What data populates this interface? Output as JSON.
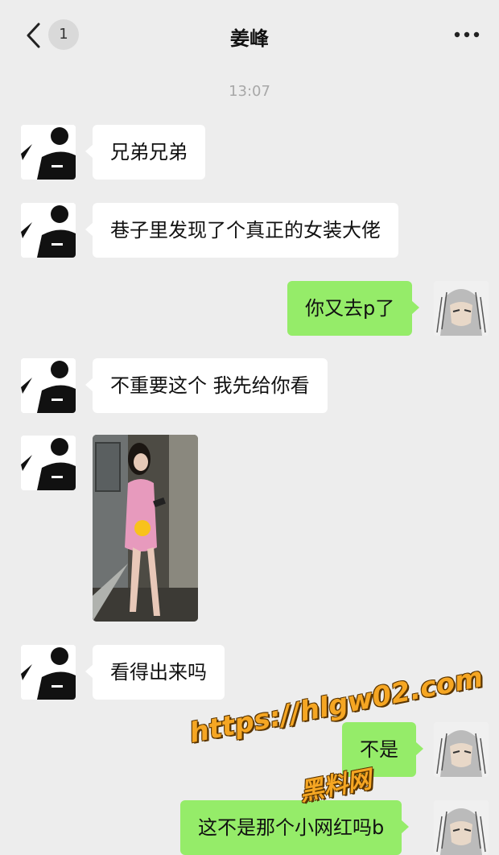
{
  "header": {
    "back_icon": "chevron-left-icon",
    "unread_badge": "1",
    "title": "姜峰",
    "more_icon": "ellipsis-icon"
  },
  "timestamp": "13:07",
  "messages": [
    {
      "side": "left",
      "type": "text",
      "text": "兄弟兄弟"
    },
    {
      "side": "left",
      "type": "text",
      "text": "巷子里发现了个真正的女装大佬"
    },
    {
      "side": "right",
      "type": "text",
      "text": "你又去p了"
    },
    {
      "side": "left",
      "type": "text",
      "text": "不重要这个 我先给你看"
    },
    {
      "side": "left",
      "type": "image",
      "text": ""
    },
    {
      "side": "left",
      "type": "text",
      "text": "看得出来吗"
    },
    {
      "side": "right",
      "type": "text",
      "text": "不是"
    },
    {
      "side": "right",
      "type": "text",
      "text": "这不是那个小网红吗b"
    }
  ],
  "watermark": {
    "url": "https://hlgw02.com",
    "label": "黑料网"
  },
  "colors": {
    "background": "#ededed",
    "sent_bubble": "#95ec69",
    "received_bubble": "#ffffff"
  }
}
